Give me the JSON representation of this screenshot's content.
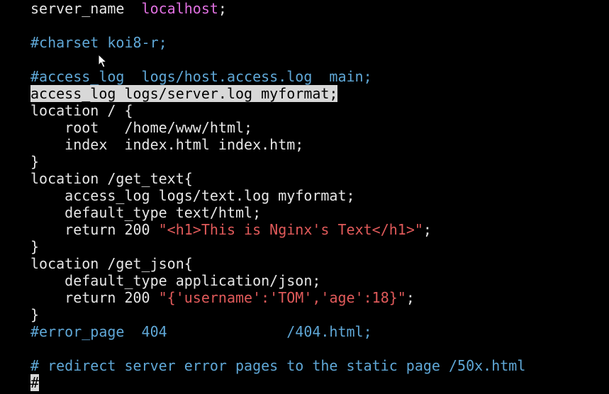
{
  "editor": {
    "lines": [
      {
        "segments": [
          {
            "text": "server_name  ",
            "style": "plain"
          },
          {
            "text": "localhost",
            "style": "host"
          },
          {
            "text": ";",
            "style": "plain"
          }
        ]
      },
      {
        "segments": []
      },
      {
        "segments": [
          {
            "text": "#charset koi8-r;",
            "style": "comment"
          }
        ]
      },
      {
        "segments": []
      },
      {
        "segments": [
          {
            "text": "#access_log  logs/host.access.log  main;",
            "style": "comment"
          }
        ]
      },
      {
        "segments": [
          {
            "text": "access_log logs/server.log myformat;",
            "style": "selected"
          }
        ]
      },
      {
        "segments": [
          {
            "text": "location / {",
            "style": "plain"
          }
        ]
      },
      {
        "segments": [
          {
            "text": "    root   /home/www/html;",
            "style": "plain"
          }
        ]
      },
      {
        "segments": [
          {
            "text": "    index  index.html index.htm;",
            "style": "plain"
          }
        ]
      },
      {
        "segments": [
          {
            "text": "}",
            "style": "plain"
          }
        ]
      },
      {
        "segments": [
          {
            "text": "location /get_text{",
            "style": "plain"
          }
        ]
      },
      {
        "segments": [
          {
            "text": "    access_log logs/text.log myformat;",
            "style": "plain"
          }
        ]
      },
      {
        "segments": [
          {
            "text": "    default_type text/html;",
            "style": "plain"
          }
        ]
      },
      {
        "segments": [
          {
            "text": "    return 200 ",
            "style": "plain"
          },
          {
            "text": "\"<h1>This is Nginx's Text</h1>\"",
            "style": "string"
          },
          {
            "text": ";",
            "style": "plain"
          }
        ]
      },
      {
        "segments": [
          {
            "text": "}",
            "style": "plain"
          }
        ]
      },
      {
        "segments": [
          {
            "text": "location /get_json{",
            "style": "plain"
          }
        ]
      },
      {
        "segments": [
          {
            "text": "    default_type application/json;",
            "style": "plain"
          }
        ]
      },
      {
        "segments": [
          {
            "text": "    return 200 ",
            "style": "plain"
          },
          {
            "text": "\"{'username':'TOM','age':18}\"",
            "style": "string"
          },
          {
            "text": ";",
            "style": "plain"
          }
        ]
      },
      {
        "segments": [
          {
            "text": "}",
            "style": "plain"
          }
        ]
      },
      {
        "segments": [
          {
            "text": "#error_page  404              /404.html;",
            "style": "comment"
          }
        ]
      },
      {
        "segments": []
      },
      {
        "segments": [
          {
            "text": "# redirect server error pages to the static page /50x.html",
            "style": "comment"
          }
        ]
      },
      {
        "segments": [
          {
            "text": "#",
            "style": "cursor"
          }
        ]
      }
    ]
  },
  "colors": {
    "background": "#000000",
    "text": "#e6e6e6",
    "comment": "#5fa7d6",
    "host": "#e070e0",
    "string": "#e05a5a",
    "selection": "#d8d8d8"
  },
  "icons": {
    "mouse": "mouse-pointer-icon"
  }
}
